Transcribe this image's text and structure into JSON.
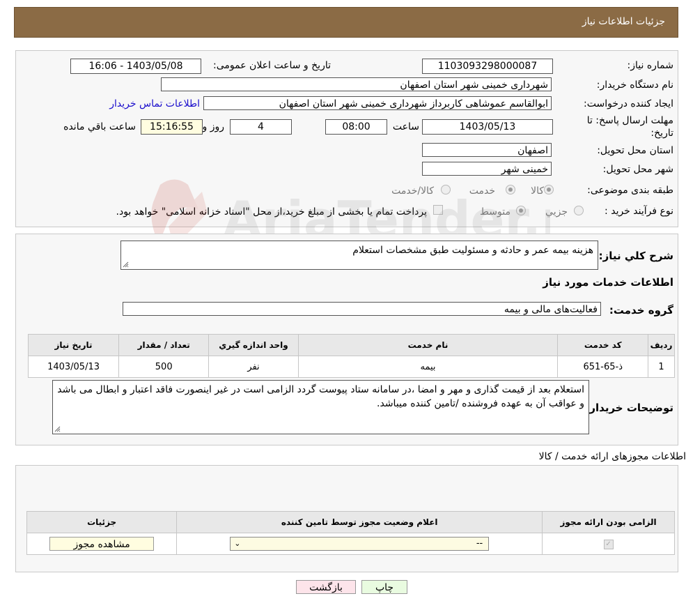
{
  "header": {
    "title": "جزئیات اطلاعات نیاز"
  },
  "fields": {
    "need_number_label": "شماره نیاز:",
    "need_number": "1103093298000087",
    "announce_label": "تاریخ و ساعت اعلان عمومی:",
    "announce_value": "1403/05/08 - 16:06",
    "buyer_label": "نام دستگاه خریدار:",
    "buyer": "شهرداری خمینی شهر استان اصفهان",
    "creator_label": "ایجاد کننده درخواست:",
    "creator": "ابوالقاسم عموشاهی کاربرداز شهرداری خمینی شهر استان اصفهان",
    "contact_link": "اطلاعات تماس خریدار",
    "deadline_label_1": "مهلت ارسال پاسخ: تا",
    "deadline_label_2": "تاریخ:",
    "deadline_date": "1403/05/13",
    "time_label": "ساعت",
    "deadline_time": "08:00",
    "days_value": "4",
    "days_label": "روز و",
    "remaining_time": "15:16:55",
    "remaining_label": "ساعت باقي مانده",
    "province_label": "استان محل تحویل:",
    "province": "اصفهان",
    "city_label": "شهر محل تحویل:",
    "city": "خمینی شهر",
    "category_label": "طبقه بندی موضوعی:",
    "category_options": [
      "کالا",
      "خدمت",
      "کالا/خدمت"
    ],
    "process_label": "نوع فرآیند خرید :",
    "process_options": [
      "جزيي",
      "متوسط"
    ],
    "process_note": "پرداخت تمام یا بخشی از مبلغ خرید،از محل \"اسناد خزانه اسلامی\" خواهد بود."
  },
  "summary": {
    "label": "شرح کلي نياز:",
    "text": "هزینه بیمه عمر و حادثه و مسئولیت طبق مشخصات استعلام",
    "services_title": "اطلاعات خدمات مورد نياز",
    "group_label": "گروه خدمت:",
    "group_value": "فعالیت‌های مالی و بیمه",
    "table_headers": [
      "رديف",
      "کد خدمت",
      "نام خدمت",
      "واحد اندازه گيري",
      "تعداد / مقدار",
      "تاريخ نياز"
    ],
    "rows": [
      [
        "1",
        "ذ-65-651",
        "بیمه",
        "نفر",
        "500",
        "1403/05/13"
      ]
    ],
    "notes_label": "توضيحات خريدار:",
    "notes_text": "استعلام بعد از قیمت گذاری و مهر و امضا ،در سامانه ستاد پیوست گردد الزامی است در غیر اینصورت فاقد اعتبار و ابطال می باشد و عواقب آن به عهده فروشنده /تامین کننده میباشد."
  },
  "permits": {
    "title": "اطلاعات مجوزهای ارائه خدمت / کالا",
    "headers": [
      "الزامی بودن ارائه مجوز",
      "اعلام وضعیت مجوز توسط تامین کننده",
      "جزئیات"
    ],
    "select_value": "--",
    "view_button": "مشاهده مجوز"
  },
  "buttons": {
    "print": "چاپ",
    "back": "بازگشت"
  },
  "watermark": "AriaTender.net",
  "colors": {
    "header_bg": "#8b6b45",
    "link": "#1a0dcc",
    "print_bg": "#e9fbe0",
    "back_bg": "#fde4ea",
    "view_bg": "#fffde0",
    "select_bg": "#fdfbe2"
  }
}
